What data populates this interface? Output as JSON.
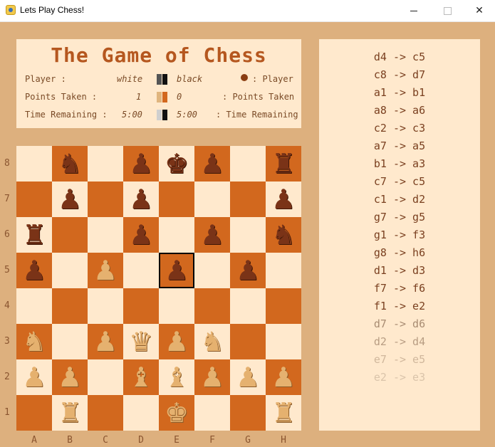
{
  "window": {
    "title": "Lets Play Chess!"
  },
  "header": {
    "title": "The Game of Chess",
    "row1": {
      "left_label": "Player :",
      "white_value": "white",
      "black_value": "black",
      "right_label": ": Player"
    },
    "row2": {
      "left_label": "Points Taken :",
      "white_value": "1",
      "black_value": "0",
      "right_label": ": Points Taken"
    },
    "row3": {
      "left_label": "Time Remaining :",
      "white_value": "5:00",
      "black_value": "5:00",
      "right_label": ": Time Remaining"
    }
  },
  "board": {
    "files": [
      "A",
      "B",
      "C",
      "D",
      "E",
      "F",
      "G",
      "H"
    ],
    "ranks": [
      "8",
      "7",
      "6",
      "5",
      "4",
      "3",
      "2",
      "1"
    ],
    "selected_square": "e5",
    "pieces": {
      "b8": "bN",
      "d8": "bP",
      "e8": "bK",
      "f8": "bP",
      "h8": "bR",
      "b7": "bP",
      "d7": "bP",
      "h7": "bP",
      "a6": "bR",
      "d6": "bP",
      "f6": "bP",
      "h6": "bN",
      "a5": "bP",
      "c5": "wP",
      "e5": "bP",
      "g5": "bP",
      "a3": "wN",
      "c3": "wP",
      "d3": "wQ",
      "e3": "wP",
      "f3": "wN",
      "a2": "wP",
      "b2": "wP",
      "d2": "wB",
      "e2": "wB",
      "f2": "wP",
      "g2": "wP",
      "h2": "wP",
      "b1": "wR",
      "e1": "wK",
      "h1": "wR"
    }
  },
  "moves": [
    {
      "text": "d4 -> c5",
      "faded": false
    },
    {
      "text": "c8 -> d7",
      "faded": false
    },
    {
      "text": "a1 -> b1",
      "faded": false
    },
    {
      "text": "a8 -> a6",
      "faded": false
    },
    {
      "text": "c2 -> c3",
      "faded": false
    },
    {
      "text": "a7 -> a5",
      "faded": false
    },
    {
      "text": "b1 -> a3",
      "faded": false
    },
    {
      "text": "c7 -> c5",
      "faded": false
    },
    {
      "text": "c1 -> d2",
      "faded": false
    },
    {
      "text": "g7 -> g5",
      "faded": false
    },
    {
      "text": "g1 -> f3",
      "faded": false
    },
    {
      "text": "g8 -> h6",
      "faded": false
    },
    {
      "text": "d1 -> d3",
      "faded": false
    },
    {
      "text": "f7 -> f6",
      "faded": false
    },
    {
      "text": "f1 -> e2",
      "faded": false
    },
    {
      "text": "d7 -> d6",
      "faded": true,
      "color": "#a88c72"
    },
    {
      "text": "d2 -> d4",
      "faded": true,
      "color": "#b89d83"
    },
    {
      "text": "e7 -> e5",
      "faded": true,
      "color": "#d0b79c"
    },
    {
      "text": "e2 -> e3",
      "faded": true,
      "color": "#dac4aa"
    }
  ],
  "colors": {
    "background": "#ddb07e",
    "panel": "#ffe9cd",
    "light_square": "#ffe9cd",
    "dark_square": "#d2681e",
    "title": "#b5571f",
    "text": "#7a4a26",
    "move_text": "#7a4020"
  }
}
